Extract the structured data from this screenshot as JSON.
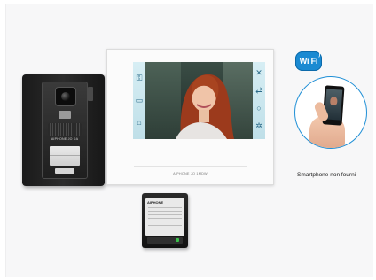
{
  "doorstation": {
    "brand": "AIPHONE JO DA"
  },
  "monitor": {
    "brand": "AIPHONE JO 1MDW",
    "left_icons": [
      "key-icon",
      "door-icon",
      "gate-icon"
    ],
    "right_icons": [
      "mute-icon",
      "transfer-icon",
      "light-icon",
      "settings-icon"
    ]
  },
  "wifi_badge": {
    "text": "Wi Fi",
    "color": "#1a8ad2"
  },
  "smartphone": {
    "caption": "Smartphone non fourni"
  },
  "power_supply": {
    "brand": "AIPHONE"
  },
  "colors": {
    "circle_border": "#1f8fd6",
    "screen_ui": "#cfe8ef"
  }
}
